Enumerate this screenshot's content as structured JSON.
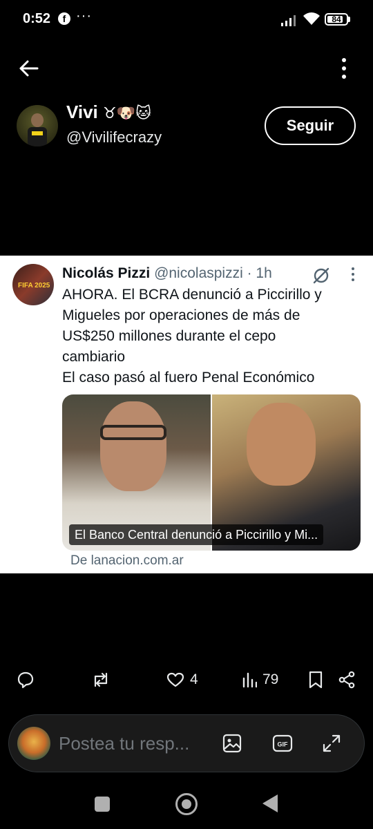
{
  "status_bar": {
    "time": "0:52",
    "app_icon": "facebook-icon",
    "more": "···",
    "battery": "84"
  },
  "header": {
    "back_icon": "arrow-left-icon",
    "menu_icon": "overflow-vertical-icon",
    "display_name": "Vivi",
    "display_emoji": "♉🐶🐱",
    "handle": "@Vivilifecrazy",
    "follow_label": "Seguir"
  },
  "quoted_post": {
    "author_name": "Nicolás Pizzi",
    "author_handle": "@nicolaspizzi",
    "time": " · 1h",
    "avatar_badge": "FIFA 2025",
    "text_lines": [
      "AHORA. El BCRA denunció a Piccirillo y",
      "Migueles por operaciones de más de",
      "US$250 millones durante el cepo",
      "cambiario",
      "El caso pasó al fuero Penal Económico"
    ],
    "media_caption": "El Banco Central denunció a Piccirillo y Mi...",
    "source": "De lanacion.com.ar"
  },
  "actions": {
    "reply_count": "",
    "repost_count": "",
    "like_count": "4",
    "views_count": "79"
  },
  "composer": {
    "placeholder": "Postea tu resp..."
  },
  "colors": {
    "background": "#000000",
    "card_background": "#ffffff",
    "muted_text": "#536471",
    "composer_bg": "#1a1a1a"
  }
}
